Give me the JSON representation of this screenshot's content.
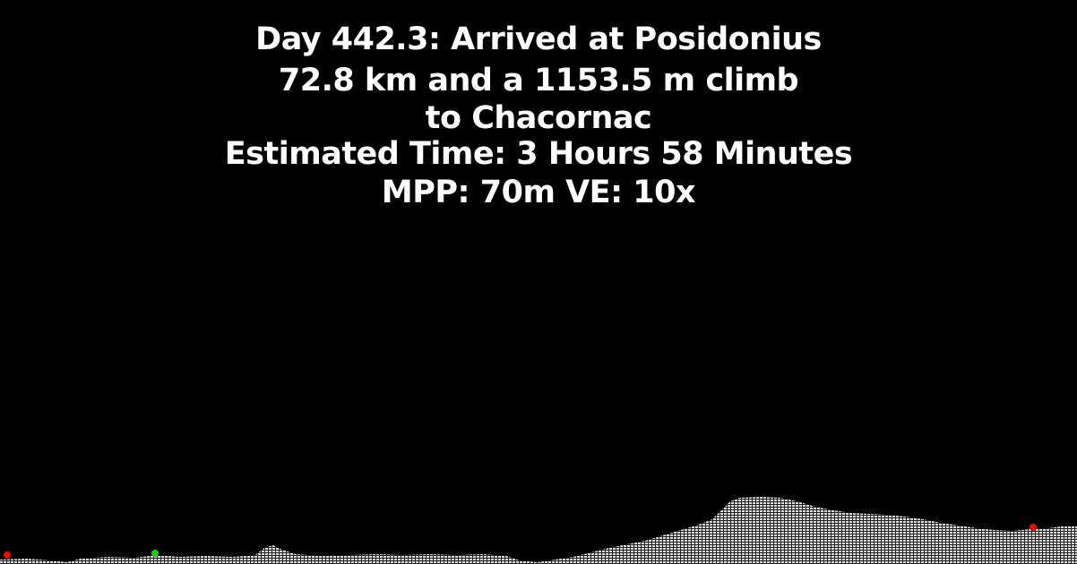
{
  "header": {
    "line1": "Day 442.3: Arrived at Posidonius",
    "line2": "72.8 km and a 1153.5 m climb",
    "line3": "to Chacornac",
    "line4": "Estimated Time: 3 Hours 58 Minutes",
    "line5": "MPP: 70m VE: 10x"
  },
  "colors": {
    "background": "#000000",
    "text": "#ffffff",
    "terrain_fill": "#d8d8d8",
    "start_marker": "#e01010",
    "current_marker": "#19d019",
    "end_marker": "#e01010"
  }
}
